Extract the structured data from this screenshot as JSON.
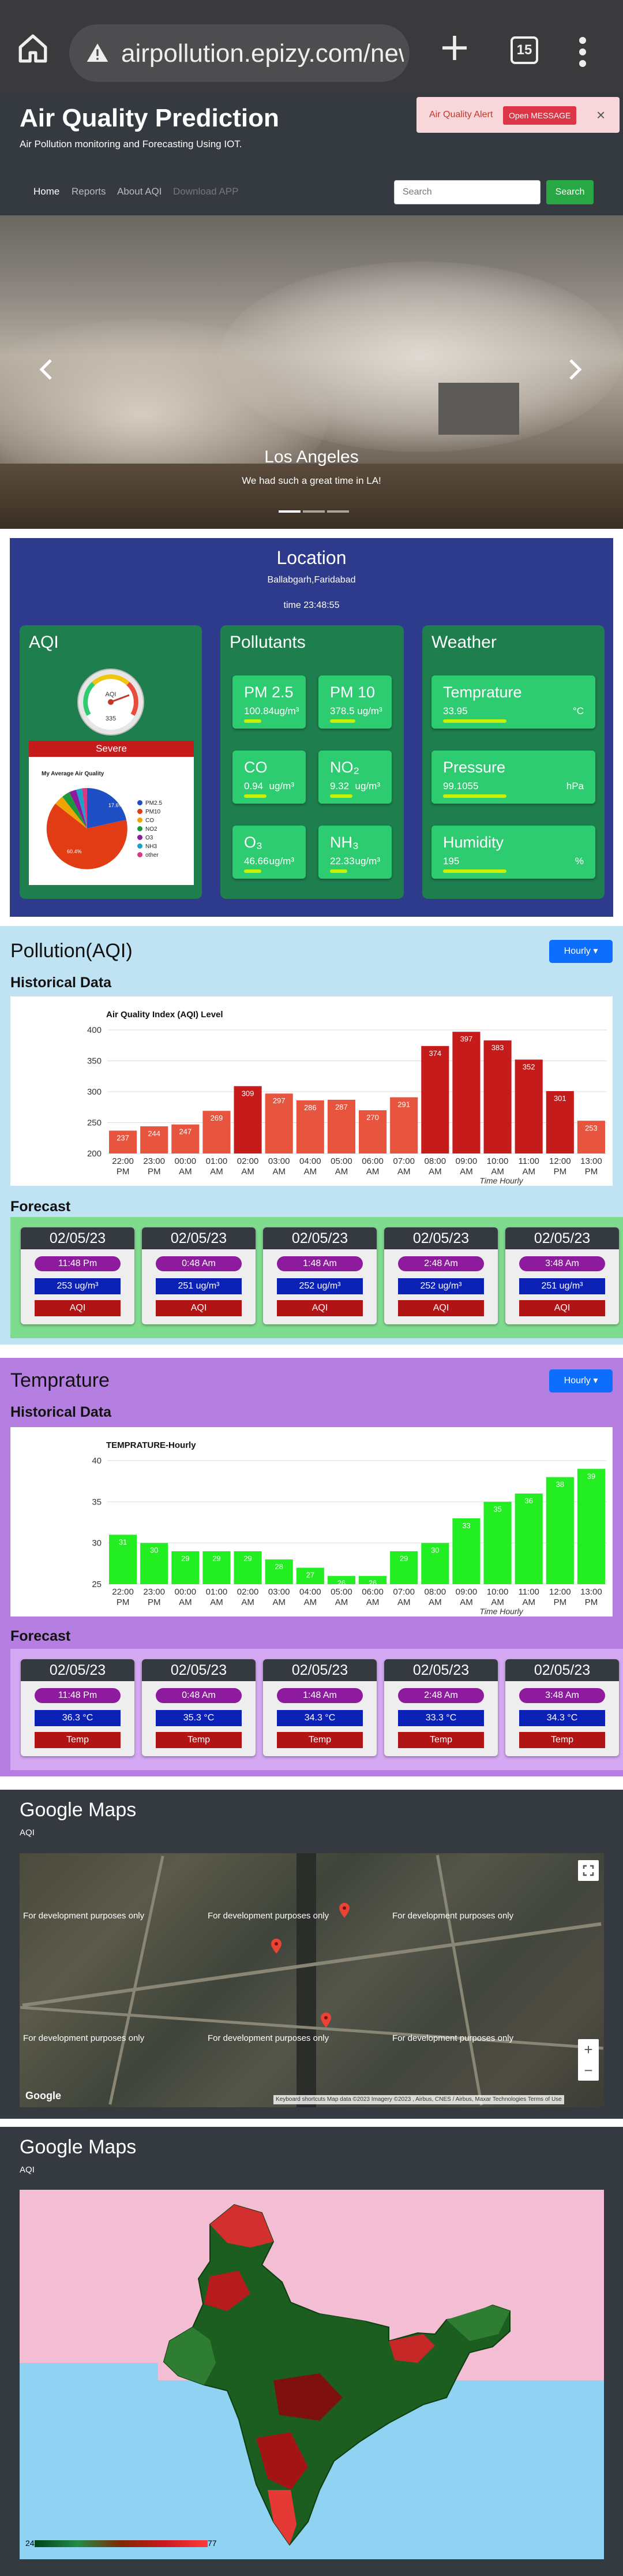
{
  "browser": {
    "url": "airpollution.epizy.com/new",
    "tab_count": "15"
  },
  "header": {
    "title": "Air Quality Prediction",
    "subtitle": "Air Pollution monitoring and Forecasting Using IOT.",
    "nav": [
      "Home",
      "Reports",
      "About AQI",
      "Download APP"
    ],
    "search_placeholder": "Search",
    "search_button": "Search"
  },
  "alert": {
    "text": "Air Quality Alert",
    "button": "Open MESSAGE",
    "close": "×"
  },
  "carousel": {
    "title": "Los Angeles",
    "caption": "We had such a great time in LA!"
  },
  "location": {
    "title": "Location",
    "place": "Ballabgarh,Faridabad",
    "time": "time 23:48:55"
  },
  "aqi_panel": {
    "title": "AQI",
    "gauge_label": "AQI",
    "gauge_value": "335",
    "status": "Severe",
    "pie_title": "My Average Air Quality",
    "pie_labels": {
      "pm25": "17.6%",
      "pm10": "60.4%"
    }
  },
  "pollutants": {
    "title": "Pollutants",
    "items": [
      {
        "label": "PM 2.5",
        "value": "100.84ug/m³",
        "unit": "",
        "level": 0.35
      },
      {
        "label": "PM 10",
        "value": "378.5 ug/m³",
        "unit": "",
        "level": 0.5
      },
      {
        "label": "CO",
        "value": "0.94",
        "unit": "ug/m³",
        "level": 0.45
      },
      {
        "label": "NO₂",
        "value": "9.32",
        "unit": "ug/m³",
        "level": 0.45
      },
      {
        "label": "O₃",
        "value": "46.66",
        "unit": "ug/m³",
        "level": 0.35
      },
      {
        "label": "NH₃",
        "value": "22.33",
        "unit": "ug/m³",
        "level": 0.35
      }
    ]
  },
  "weather": {
    "title": "Weather",
    "items": [
      {
        "label": "Temprature",
        "value": "33.95",
        "unit": "°C",
        "level": 0.45
      },
      {
        "label": "Pressure",
        "value": "99.1055",
        "unit": "hPa",
        "level": 0.45
      },
      {
        "label": "Humidity",
        "value": "195",
        "unit": "%",
        "level": 0.45
      }
    ]
  },
  "pollution_section": {
    "title": "Pollution(AQI)",
    "hourly_button": "Hourly",
    "historical_label": "Historical Data",
    "forecast_label": "Forecast",
    "forecast": [
      {
        "date": "02/05/23",
        "time": "11:48 Pm",
        "value": "253 ug/m³",
        "kind": "AQI"
      },
      {
        "date": "02/05/23",
        "time": "0:48 Am",
        "value": "251 ug/m³",
        "kind": "AQI"
      },
      {
        "date": "02/05/23",
        "time": "1:48 Am",
        "value": "252 ug/m³",
        "kind": "AQI"
      },
      {
        "date": "02/05/23",
        "time": "2:48 Am",
        "value": "252 ug/m³",
        "kind": "AQI"
      },
      {
        "date": "02/05/23",
        "time": "3:48 Am",
        "value": "251 ug/m³",
        "kind": "AQI"
      }
    ]
  },
  "temperature_section": {
    "title": "Temprature",
    "hourly_button": "Hourly",
    "historical_label": "Historical Data",
    "forecast_label": "Forecast",
    "forecast": [
      {
        "date": "02/05/23",
        "time": "11:48 Pm",
        "value": "36.3 °C",
        "kind": "Temp"
      },
      {
        "date": "02/05/23",
        "time": "0:48 Am",
        "value": "35.3 °C",
        "kind": "Temp"
      },
      {
        "date": "02/05/23",
        "time": "1:48 Am",
        "value": "34.3 °C",
        "kind": "Temp"
      },
      {
        "date": "02/05/23",
        "time": "2:48 Am",
        "value": "33.3 °C",
        "kind": "Temp"
      },
      {
        "date": "02/05/23",
        "time": "3:48 Am",
        "value": "34.3 °C",
        "kind": "Temp"
      }
    ]
  },
  "map1": {
    "title": "Google Maps",
    "subtitle": "AQI",
    "watermark": "For development purposes only",
    "attribution": "Keyboard shortcuts   Map data ©2023 Imagery ©2023 , Airbus, CNES / Airbus, Maxar Technologies   Terms of Use"
  },
  "map2": {
    "title": "Google Maps",
    "subtitle": "AQI",
    "scale_min": "24",
    "scale_max": "77"
  },
  "colors": {
    "aqi_low": "#e8553f",
    "aqi_high": "#c51b1b",
    "temp_bar": "#22ee22",
    "pollution_bg": "#bfe3f2",
    "temp_bg": "#b47fe0"
  },
  "chart_data": [
    {
      "type": "bar",
      "title": "Air Quality Index (AQI) Level",
      "xlabel": "Time Hourly",
      "ylabel": "",
      "categories": [
        "22:00 PM",
        "23:00 PM",
        "00:00 AM",
        "01:00 AM",
        "02:00 AM",
        "03:00 AM",
        "04:00 AM",
        "05:00 AM",
        "06:00 AM",
        "07:00 AM",
        "08:00 AM",
        "09:00 AM",
        "10:00 AM",
        "11:00 AM",
        "12:00 PM",
        "13:00 PM"
      ],
      "values": [
        237,
        244,
        247,
        269,
        309,
        297,
        286,
        287,
        270,
        291,
        374,
        397,
        383,
        352,
        301,
        253
      ],
      "ylim": [
        200,
        400
      ],
      "yticks": [
        200,
        250,
        300,
        350,
        400
      ],
      "grid": true
    },
    {
      "type": "bar",
      "title": "TEMPRATURE-Hourly",
      "xlabel": "Time Hourly",
      "ylabel": "",
      "categories": [
        "22:00 PM",
        "23:00 PM",
        "00:00 AM",
        "01:00 AM",
        "02:00 AM",
        "03:00 AM",
        "04:00 AM",
        "05:00 AM",
        "06:00 AM",
        "07:00 AM",
        "08:00 AM",
        "09:00 AM",
        "10:00 AM",
        "11:00 AM",
        "12:00 PM",
        "13:00 PM"
      ],
      "values": [
        31,
        30,
        29,
        29,
        29,
        28,
        27,
        26,
        26,
        29,
        30,
        33,
        35,
        36,
        38,
        39
      ],
      "ylim": [
        25,
        40
      ],
      "yticks": [
        25,
        30,
        35,
        40
      ],
      "grid": true
    }
  ]
}
